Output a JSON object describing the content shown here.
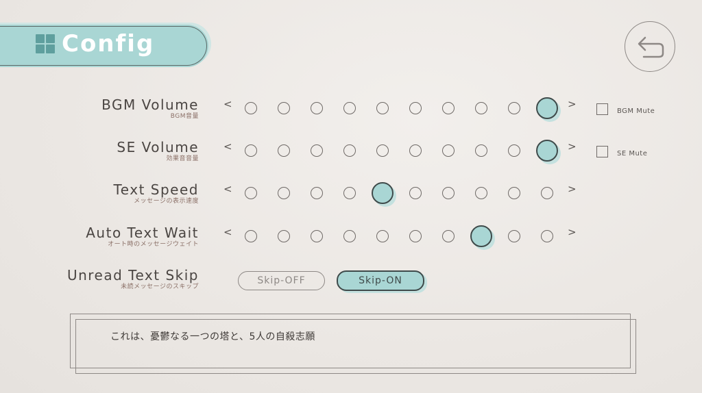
{
  "header": {
    "title": "Config",
    "icon": "grid-icon"
  },
  "back_button": {
    "icon": "back-arrow-icon"
  },
  "settings": [
    {
      "key": "bgm",
      "label": "BGM Volume",
      "sublabel": "BGM音量",
      "level": 10,
      "max": 10,
      "mute_label": "BGM Mute",
      "muted": false
    },
    {
      "key": "se",
      "label": "SE Volume",
      "sublabel": "効果音音量",
      "level": 10,
      "max": 10,
      "mute_label": "SE Mute",
      "muted": false
    },
    {
      "key": "text_speed",
      "label": "Text Speed",
      "sublabel": "メッセージの表示速度",
      "level": 5,
      "max": 10
    },
    {
      "key": "auto_wait",
      "label": "Auto Text Wait",
      "sublabel": "オート時のメッセージウェイト",
      "level": 8,
      "max": 10
    }
  ],
  "skip": {
    "label": "Unread Text Skip",
    "sublabel": "未読メッセージのスキップ",
    "off_label": "Skip-OFF",
    "on_label": "Skip-ON",
    "selected": "on"
  },
  "arrows": {
    "left": "<",
    "right": ">"
  },
  "preview_text": "これは、憂鬱なる一つの塔と、5人の自殺志願",
  "colors": {
    "accent": "#a9d6d4",
    "accent_dark": "#5f9f9e",
    "background": "#ebe7e3"
  }
}
